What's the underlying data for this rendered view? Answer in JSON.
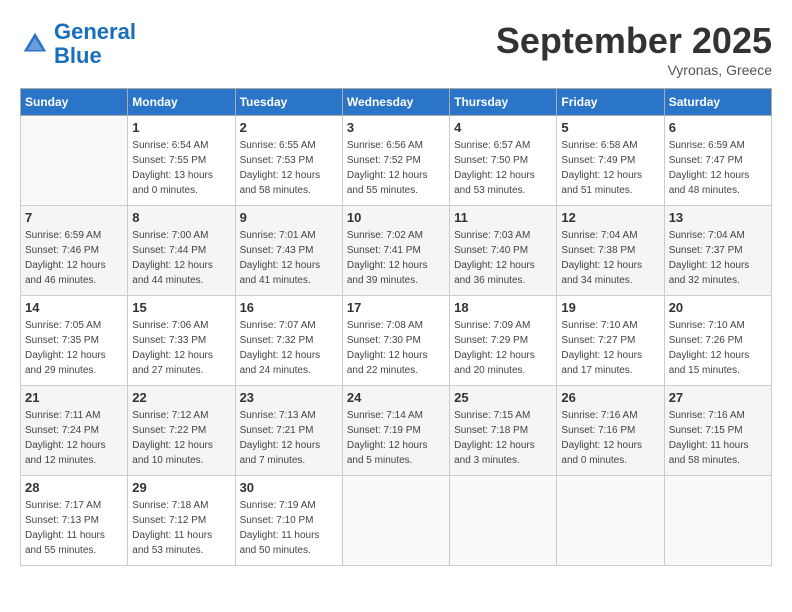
{
  "header": {
    "logo_line1": "General",
    "logo_line2": "Blue",
    "month": "September 2025",
    "location": "Vyronas, Greece"
  },
  "days_of_week": [
    "Sunday",
    "Monday",
    "Tuesday",
    "Wednesday",
    "Thursday",
    "Friday",
    "Saturday"
  ],
  "weeks": [
    [
      {
        "day": "",
        "sunrise": "",
        "sunset": "",
        "daylight": ""
      },
      {
        "day": "1",
        "sunrise": "Sunrise: 6:54 AM",
        "sunset": "Sunset: 7:55 PM",
        "daylight": "Daylight: 13 hours and 0 minutes."
      },
      {
        "day": "2",
        "sunrise": "Sunrise: 6:55 AM",
        "sunset": "Sunset: 7:53 PM",
        "daylight": "Daylight: 12 hours and 58 minutes."
      },
      {
        "day": "3",
        "sunrise": "Sunrise: 6:56 AM",
        "sunset": "Sunset: 7:52 PM",
        "daylight": "Daylight: 12 hours and 55 minutes."
      },
      {
        "day": "4",
        "sunrise": "Sunrise: 6:57 AM",
        "sunset": "Sunset: 7:50 PM",
        "daylight": "Daylight: 12 hours and 53 minutes."
      },
      {
        "day": "5",
        "sunrise": "Sunrise: 6:58 AM",
        "sunset": "Sunset: 7:49 PM",
        "daylight": "Daylight: 12 hours and 51 minutes."
      },
      {
        "day": "6",
        "sunrise": "Sunrise: 6:59 AM",
        "sunset": "Sunset: 7:47 PM",
        "daylight": "Daylight: 12 hours and 48 minutes."
      }
    ],
    [
      {
        "day": "7",
        "sunrise": "Sunrise: 6:59 AM",
        "sunset": "Sunset: 7:46 PM",
        "daylight": "Daylight: 12 hours and 46 minutes."
      },
      {
        "day": "8",
        "sunrise": "Sunrise: 7:00 AM",
        "sunset": "Sunset: 7:44 PM",
        "daylight": "Daylight: 12 hours and 44 minutes."
      },
      {
        "day": "9",
        "sunrise": "Sunrise: 7:01 AM",
        "sunset": "Sunset: 7:43 PM",
        "daylight": "Daylight: 12 hours and 41 minutes."
      },
      {
        "day": "10",
        "sunrise": "Sunrise: 7:02 AM",
        "sunset": "Sunset: 7:41 PM",
        "daylight": "Daylight: 12 hours and 39 minutes."
      },
      {
        "day": "11",
        "sunrise": "Sunrise: 7:03 AM",
        "sunset": "Sunset: 7:40 PM",
        "daylight": "Daylight: 12 hours and 36 minutes."
      },
      {
        "day": "12",
        "sunrise": "Sunrise: 7:04 AM",
        "sunset": "Sunset: 7:38 PM",
        "daylight": "Daylight: 12 hours and 34 minutes."
      },
      {
        "day": "13",
        "sunrise": "Sunrise: 7:04 AM",
        "sunset": "Sunset: 7:37 PM",
        "daylight": "Daylight: 12 hours and 32 minutes."
      }
    ],
    [
      {
        "day": "14",
        "sunrise": "Sunrise: 7:05 AM",
        "sunset": "Sunset: 7:35 PM",
        "daylight": "Daylight: 12 hours and 29 minutes."
      },
      {
        "day": "15",
        "sunrise": "Sunrise: 7:06 AM",
        "sunset": "Sunset: 7:33 PM",
        "daylight": "Daylight: 12 hours and 27 minutes."
      },
      {
        "day": "16",
        "sunrise": "Sunrise: 7:07 AM",
        "sunset": "Sunset: 7:32 PM",
        "daylight": "Daylight: 12 hours and 24 minutes."
      },
      {
        "day": "17",
        "sunrise": "Sunrise: 7:08 AM",
        "sunset": "Sunset: 7:30 PM",
        "daylight": "Daylight: 12 hours and 22 minutes."
      },
      {
        "day": "18",
        "sunrise": "Sunrise: 7:09 AM",
        "sunset": "Sunset: 7:29 PM",
        "daylight": "Daylight: 12 hours and 20 minutes."
      },
      {
        "day": "19",
        "sunrise": "Sunrise: 7:10 AM",
        "sunset": "Sunset: 7:27 PM",
        "daylight": "Daylight: 12 hours and 17 minutes."
      },
      {
        "day": "20",
        "sunrise": "Sunrise: 7:10 AM",
        "sunset": "Sunset: 7:26 PM",
        "daylight": "Daylight: 12 hours and 15 minutes."
      }
    ],
    [
      {
        "day": "21",
        "sunrise": "Sunrise: 7:11 AM",
        "sunset": "Sunset: 7:24 PM",
        "daylight": "Daylight: 12 hours and 12 minutes."
      },
      {
        "day": "22",
        "sunrise": "Sunrise: 7:12 AM",
        "sunset": "Sunset: 7:22 PM",
        "daylight": "Daylight: 12 hours and 10 minutes."
      },
      {
        "day": "23",
        "sunrise": "Sunrise: 7:13 AM",
        "sunset": "Sunset: 7:21 PM",
        "daylight": "Daylight: 12 hours and 7 minutes."
      },
      {
        "day": "24",
        "sunrise": "Sunrise: 7:14 AM",
        "sunset": "Sunset: 7:19 PM",
        "daylight": "Daylight: 12 hours and 5 minutes."
      },
      {
        "day": "25",
        "sunrise": "Sunrise: 7:15 AM",
        "sunset": "Sunset: 7:18 PM",
        "daylight": "Daylight: 12 hours and 3 minutes."
      },
      {
        "day": "26",
        "sunrise": "Sunrise: 7:16 AM",
        "sunset": "Sunset: 7:16 PM",
        "daylight": "Daylight: 12 hours and 0 minutes."
      },
      {
        "day": "27",
        "sunrise": "Sunrise: 7:16 AM",
        "sunset": "Sunset: 7:15 PM",
        "daylight": "Daylight: 11 hours and 58 minutes."
      }
    ],
    [
      {
        "day": "28",
        "sunrise": "Sunrise: 7:17 AM",
        "sunset": "Sunset: 7:13 PM",
        "daylight": "Daylight: 11 hours and 55 minutes."
      },
      {
        "day": "29",
        "sunrise": "Sunrise: 7:18 AM",
        "sunset": "Sunset: 7:12 PM",
        "daylight": "Daylight: 11 hours and 53 minutes."
      },
      {
        "day": "30",
        "sunrise": "Sunrise: 7:19 AM",
        "sunset": "Sunset: 7:10 PM",
        "daylight": "Daylight: 11 hours and 50 minutes."
      },
      {
        "day": "",
        "sunrise": "",
        "sunset": "",
        "daylight": ""
      },
      {
        "day": "",
        "sunrise": "",
        "sunset": "",
        "daylight": ""
      },
      {
        "day": "",
        "sunrise": "",
        "sunset": "",
        "daylight": ""
      },
      {
        "day": "",
        "sunrise": "",
        "sunset": "",
        "daylight": ""
      }
    ]
  ]
}
